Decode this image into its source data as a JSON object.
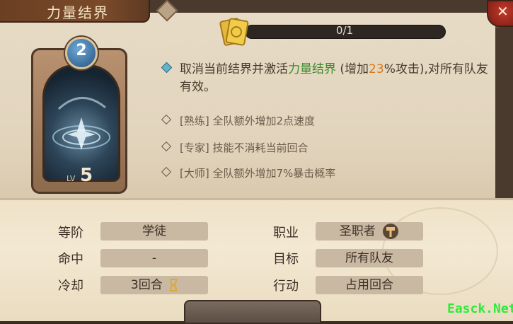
{
  "header": {
    "title": "力量结界"
  },
  "progress": {
    "text": "0/1",
    "fraction": 0
  },
  "card": {
    "level_badge": "2",
    "lv_label": "LV",
    "lv_value": "5"
  },
  "description": {
    "part1": "取消当前结界并激活",
    "highlight": "力量结界",
    "part2": " (增加",
    "percent": "23",
    "part3": "%攻击),对所有队友有效。"
  },
  "upgrades": [
    "[熟练] 全队额外增加2点速度",
    "[专家] 技能不消耗当前回合",
    "[大师] 全队额外增加7%暴击概率"
  ],
  "stats": {
    "rank_label": "等阶",
    "rank_value": "学徒",
    "hit_label": "命中",
    "hit_value": "-",
    "cooldown_label": "冷却",
    "cooldown_value": "3回合",
    "class_label": "职业",
    "class_value": "圣职者",
    "target_label": "目标",
    "target_value": "所有队友",
    "action_label": "行动",
    "action_value": "占用回合"
  },
  "close_icon": "close-icon",
  "watermark": "Easck.Net",
  "colors": {
    "highlight_green": "#3c8a2c",
    "highlight_orange": "#d9781e",
    "progress_track": "#2d2621"
  }
}
